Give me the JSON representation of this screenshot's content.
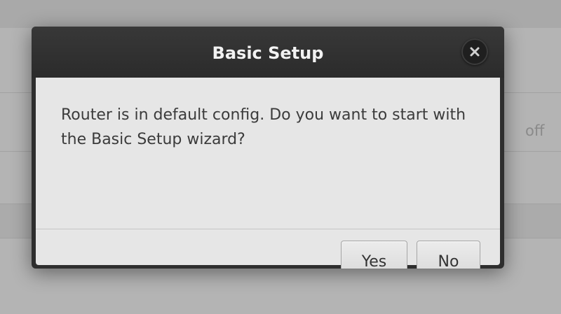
{
  "background": {
    "row_value": "off"
  },
  "dialog": {
    "title": "Basic Setup",
    "message": "Router is in default config. Do you want to start with the Basic Setup wizard?",
    "buttons": {
      "yes_label": "Yes",
      "no_label": "No"
    },
    "close_icon": "close-icon"
  },
  "colors": {
    "header": "#2e2e2e",
    "body": "#e6e6e6",
    "overlay": "#b4b4b4"
  }
}
